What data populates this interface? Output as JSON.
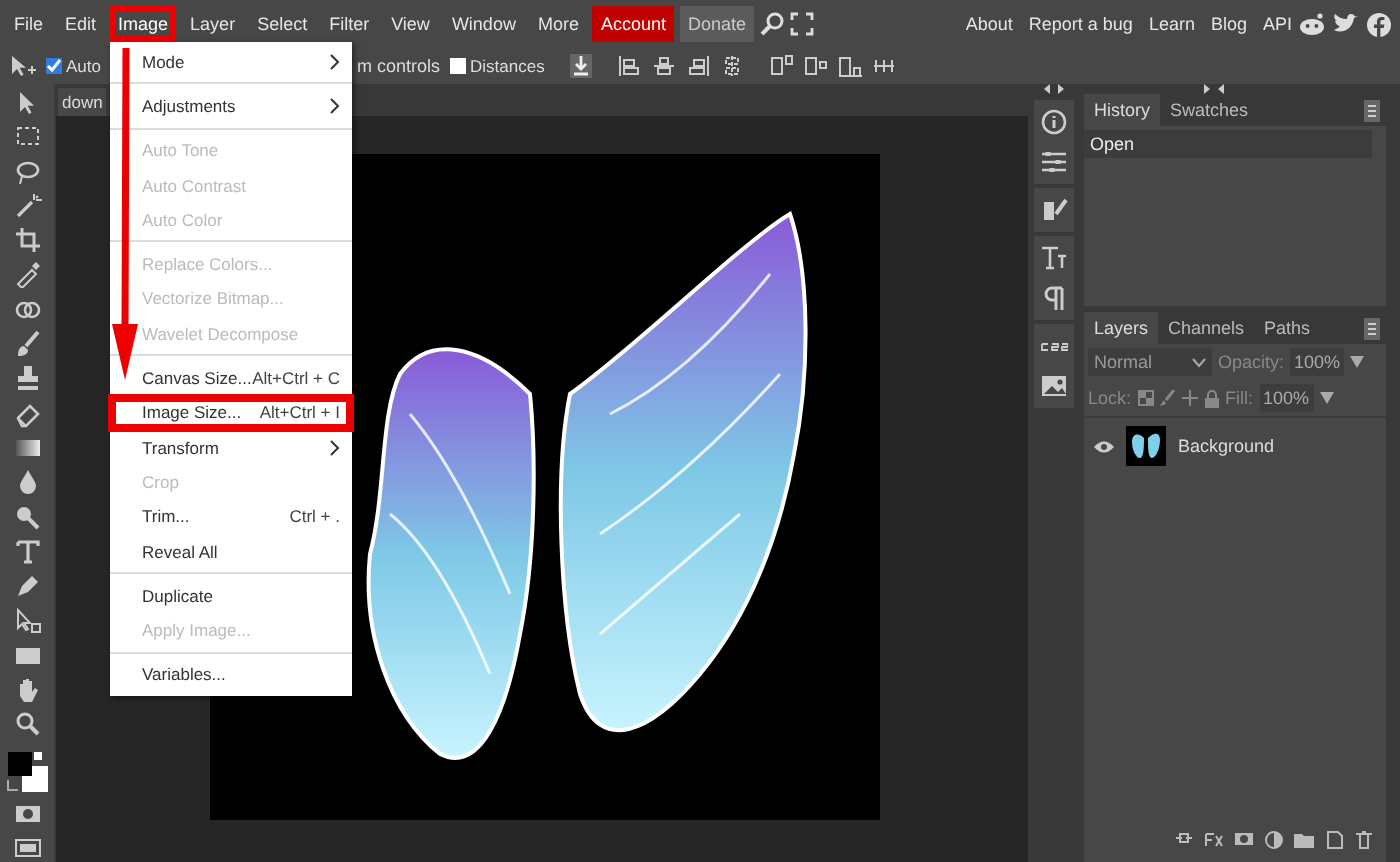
{
  "menubar": {
    "items": [
      {
        "label": "File",
        "kind": "menu",
        "selected": false
      },
      {
        "label": "Edit",
        "kind": "menu",
        "selected": false
      },
      {
        "label": "Image",
        "kind": "menu",
        "selected": true
      },
      {
        "label": "Layer",
        "kind": "menu",
        "selected": false
      },
      {
        "label": "Select",
        "kind": "menu",
        "selected": false
      },
      {
        "label": "Filter",
        "kind": "menu",
        "selected": false
      },
      {
        "label": "View",
        "kind": "menu",
        "selected": false
      },
      {
        "label": "Window",
        "kind": "menu",
        "selected": false
      },
      {
        "label": "More",
        "kind": "menu",
        "selected": false
      },
      {
        "label": "Account",
        "kind": "account",
        "selected": false
      },
      {
        "label": "Donate",
        "kind": "donate",
        "selected": false
      }
    ],
    "links": [
      "About",
      "Report a bug",
      "Learn",
      "Blog",
      "API"
    ]
  },
  "options_bar": {
    "auto_select": {
      "label": "Auto",
      "checked": true
    },
    "controls_label": "m controls",
    "distances": {
      "label": "Distances",
      "checked": false
    }
  },
  "document_tab": {
    "label": "down"
  },
  "image_menu": {
    "items": [
      {
        "kind": "item",
        "label": "Mode",
        "submenu": true,
        "disabled": false,
        "highlighted": false
      },
      {
        "kind": "separator"
      },
      {
        "kind": "item",
        "label": "Adjustments",
        "submenu": true,
        "disabled": false,
        "highlighted": false
      },
      {
        "kind": "separator"
      },
      {
        "kind": "item",
        "label": "Auto Tone",
        "disabled": true,
        "highlighted": false
      },
      {
        "kind": "item",
        "label": "Auto Contrast",
        "disabled": true,
        "highlighted": false
      },
      {
        "kind": "item",
        "label": "Auto Color",
        "disabled": true,
        "highlighted": false
      },
      {
        "kind": "separator"
      },
      {
        "kind": "item",
        "label": "Replace Colors...",
        "disabled": true,
        "highlighted": false
      },
      {
        "kind": "item",
        "label": "Vectorize Bitmap...",
        "disabled": true,
        "highlighted": false
      },
      {
        "kind": "item",
        "label": "Wavelet Decompose",
        "disabled": true,
        "highlighted": false
      },
      {
        "kind": "separator"
      },
      {
        "kind": "item",
        "label": "Canvas Size...",
        "shortcut": "Alt+Ctrl + C",
        "disabled": false,
        "highlighted": false
      },
      {
        "kind": "item",
        "label": "Image Size...",
        "shortcut": "Alt+Ctrl + I",
        "disabled": false,
        "highlighted": true
      },
      {
        "kind": "item",
        "label": "Transform",
        "submenu": true,
        "disabled": false,
        "highlighted": false
      },
      {
        "kind": "item",
        "label": "Crop",
        "disabled": true,
        "highlighted": false
      },
      {
        "kind": "item",
        "label": "Trim...",
        "shortcut": "Ctrl + .",
        "disabled": false,
        "highlighted": false
      },
      {
        "kind": "item",
        "label": "Reveal All",
        "disabled": false,
        "highlighted": false
      },
      {
        "kind": "separator"
      },
      {
        "kind": "item",
        "label": "Duplicate",
        "disabled": false,
        "highlighted": false
      },
      {
        "kind": "item",
        "label": "Apply Image...",
        "disabled": true,
        "highlighted": false
      },
      {
        "kind": "separator"
      },
      {
        "kind": "item",
        "label": "Variables...",
        "disabled": false,
        "highlighted": false
      }
    ]
  },
  "history_panel": {
    "tabs": [
      {
        "label": "History",
        "selected": true
      },
      {
        "label": "Swatches",
        "selected": false
      }
    ],
    "entries": [
      "Open"
    ]
  },
  "layers_panel": {
    "tabs": [
      {
        "label": "Layers",
        "selected": true
      },
      {
        "label": "Channels",
        "selected": false
      },
      {
        "label": "Paths",
        "selected": false
      }
    ],
    "blend_mode": "Normal",
    "opacity_label": "Opacity:",
    "opacity": "100%",
    "lock_label": "Lock:",
    "fill_label": "Fill:",
    "fill": "100%",
    "layers": [
      {
        "name": "Background",
        "visible": true
      }
    ]
  }
}
